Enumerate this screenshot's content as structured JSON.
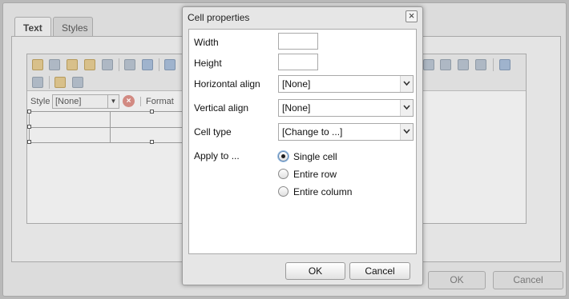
{
  "background_dialog": {
    "tabs": [
      "Text",
      "Styles"
    ],
    "toolbar": {
      "style_label": "Style",
      "style_value": "[None]",
      "format_label": "Format"
    },
    "buttons": {
      "ok": "OK",
      "cancel": "Cancel"
    }
  },
  "modal": {
    "title": "Cell properties",
    "fields": {
      "width": {
        "label": "Width",
        "value": ""
      },
      "height": {
        "label": "Height",
        "value": ""
      },
      "horizontal_align": {
        "label": "Horizontal align",
        "value": "[None]"
      },
      "vertical_align": {
        "label": "Vertical align",
        "value": "[None]"
      },
      "cell_type": {
        "label": "Cell type",
        "value": "[Change to ...]"
      }
    },
    "apply_to": {
      "label": "Apply to ...",
      "options": [
        {
          "label": "Single cell",
          "checked": true
        },
        {
          "label": "Entire row",
          "checked": false
        },
        {
          "label": "Entire column",
          "checked": false
        }
      ]
    },
    "buttons": {
      "ok": "OK",
      "cancel": "Cancel"
    }
  },
  "colors": {
    "modal_bg": "#e6e6e6",
    "overlay_bg": "#b9b9b9",
    "radio_focus": "#5b84b1"
  }
}
